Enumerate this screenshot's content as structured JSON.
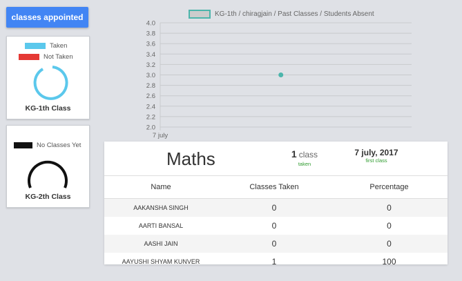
{
  "sidebar": {
    "button_label": "classes appointed",
    "card1": {
      "legend": [
        {
          "label": "Taken",
          "color": "#5bc8ec"
        },
        {
          "label": "Not Taken",
          "color": "#e53935"
        }
      ],
      "title": "KG-1th Class",
      "ring_color": "#5bc8ec"
    },
    "card2": {
      "legend": [
        {
          "label": "No Classes Yet",
          "color": "#111111"
        }
      ],
      "title": "KG-2th Class",
      "ring_color": "#111111"
    }
  },
  "chart_data": {
    "type": "scatter",
    "legend": "KG-1th / chiragjain / Past Classes / Students Absent",
    "categories": [
      "7 july"
    ],
    "points": [
      {
        "x": "7 july",
        "y": 3.0
      }
    ],
    "ylim": [
      2.0,
      4.0
    ],
    "yticks": [
      "4.0",
      "3.8",
      "3.6",
      "3.4",
      "3.2",
      "3.0",
      "2.8",
      "2.6",
      "2.4",
      "2.2",
      "2.0"
    ],
    "grid": true,
    "point_color": "#4cb5ab"
  },
  "panel": {
    "subject": "Maths",
    "class_count": "1",
    "class_unit": "class",
    "taken_label": "taken",
    "date": "7 july, 2017",
    "first_class_label": "first class",
    "headers": [
      "Name",
      "Classes Taken",
      "Percentage"
    ],
    "rows": [
      {
        "name": "AAKANSHA SINGH",
        "taken": "0",
        "percentage": "0"
      },
      {
        "name": "AARTI BANSAL",
        "taken": "0",
        "percentage": "0"
      },
      {
        "name": "AASHI JAIN",
        "taken": "0",
        "percentage": "0"
      },
      {
        "name": "AAYUSHI SHYAM KUNVER",
        "taken": "1",
        "percentage": "100"
      }
    ]
  }
}
